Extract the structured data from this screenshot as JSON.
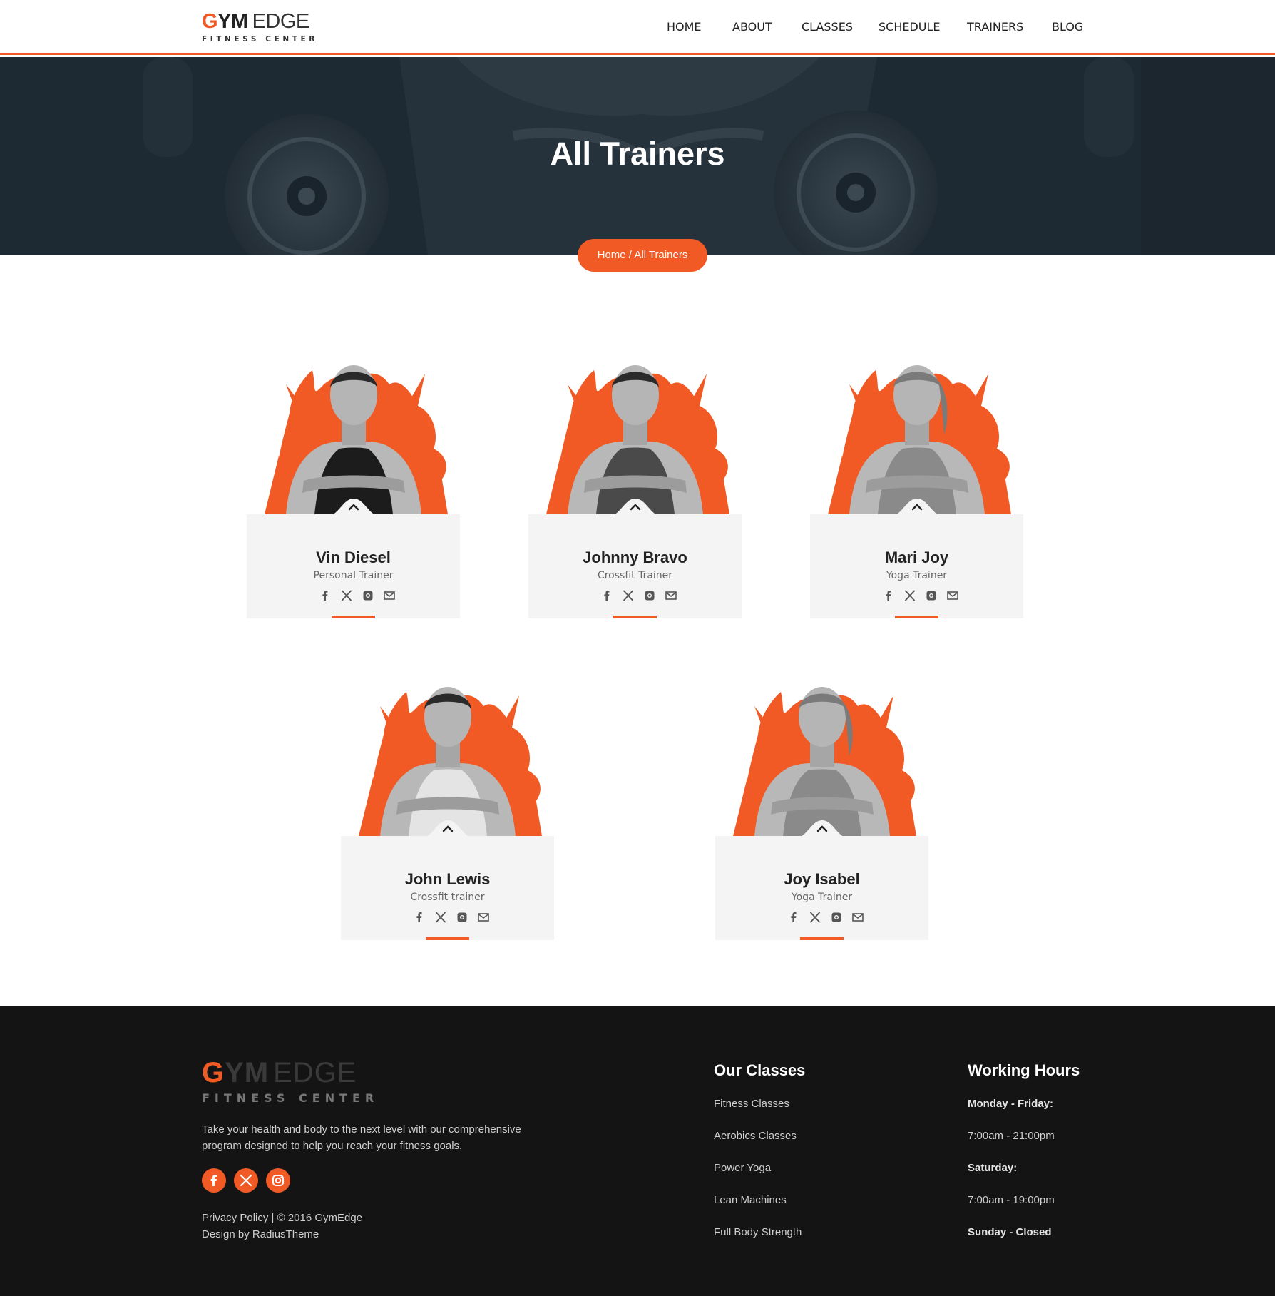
{
  "header": {
    "logo": {
      "part1": "G",
      "part2": "YM",
      "part3": "EDGE",
      "tagline": "FITNESS CENTER"
    },
    "nav": [
      "HOME",
      "ABOUT",
      "CLASSES",
      "SCHEDULE",
      "TRAINERS",
      "BLOG"
    ]
  },
  "hero": {
    "title": "All Trainers",
    "breadcrumb": {
      "home": "Home",
      "separator": " / ",
      "current": "All Trainers"
    }
  },
  "trainers": [
    {
      "name": "Vin Diesel",
      "role": "Personal Trainer"
    },
    {
      "name": "Johnny Bravo",
      "role": "Crossfit Trainer"
    },
    {
      "name": "Mari Joy",
      "role": "Yoga Trainer"
    },
    {
      "name": "John Lewis",
      "role": "Crossfit trainer"
    },
    {
      "name": "Joy Isabel",
      "role": "Yoga Trainer"
    }
  ],
  "trainer_social_icons": [
    "facebook-icon",
    "x-icon",
    "instagram-icon",
    "email-icon"
  ],
  "footer": {
    "logo": {
      "part1": "G",
      "part2": "YM",
      "part3": "EDGE",
      "tagline": "FITNESS CENTER"
    },
    "description": "Take your health and body to the next level with our comprehensive program designed to help you reach your fitness goals.",
    "social_icons": [
      "facebook-icon",
      "x-icon",
      "instagram-icon"
    ],
    "privacy": "Privacy Policy",
    "copyright": " | © 2016 GymEdge",
    "credit": "Design by RadiusTheme",
    "classes_heading": "Our Classes",
    "classes": [
      "Fitness Classes",
      "Aerobics Classes",
      "Power Yoga",
      "Lean Machines",
      "Full Body Strength"
    ],
    "hours_heading": "Working Hours",
    "hours": [
      {
        "text": "Monday - Friday:",
        "bold": true
      },
      {
        "text": "7:00am - 21:00pm",
        "bold": false
      },
      {
        "text": "Saturday:",
        "bold": true
      },
      {
        "text": "7:00am - 19:00pm",
        "bold": false
      },
      {
        "text": "Sunday - Closed",
        "bold": true
      }
    ]
  },
  "colors": {
    "accent": "#f15a24",
    "hero_bg": "#1e2a33",
    "footer_bg": "#141414",
    "card_bg": "#f4f4f4"
  }
}
